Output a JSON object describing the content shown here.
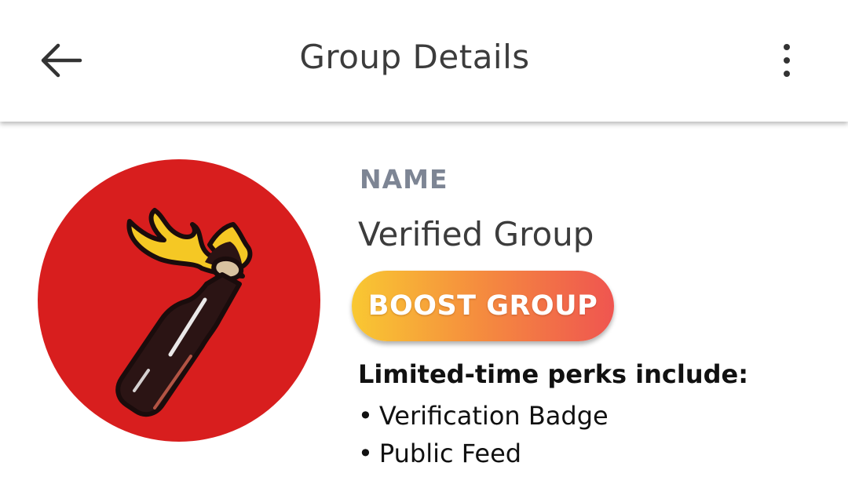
{
  "header": {
    "title": "Group Details",
    "back_icon": "arrow-left-icon",
    "menu_icon": "more-vertical-icon"
  },
  "group": {
    "name_label": "NAME",
    "name": "Verified Group",
    "avatar_icon": "molotov-bottle-icon"
  },
  "boost": {
    "label": "BOOST GROUP",
    "gradient_colors": [
      "#f9c832",
      "#f58d3e",
      "#ef5550"
    ]
  },
  "perks": {
    "title": "Limited-time perks include:",
    "bullet": "•",
    "items": [
      {
        "text": "Verification Badge"
      },
      {
        "text": "Public Feed"
      }
    ]
  },
  "colors": {
    "avatar_background": "#d81e1e",
    "name_label": "#7d8594",
    "text_primary": "#3c3c3c"
  }
}
